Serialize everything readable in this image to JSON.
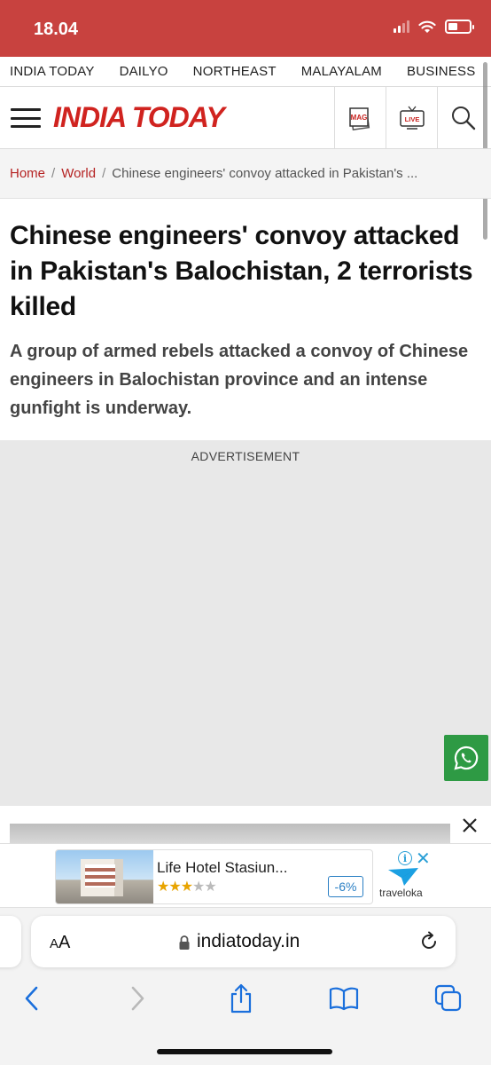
{
  "status_bar": {
    "time": "18.04",
    "bg_color": "#c8423f",
    "icons": [
      "signal-icon",
      "wifi-icon",
      "battery-icon"
    ]
  },
  "top_nav": {
    "items": [
      "INDIA TODAY",
      "DAILYO",
      "NORTHEAST",
      "MALAYALAM",
      "BUSINESS"
    ]
  },
  "header": {
    "logo": "INDIA TODAY",
    "brand_color": "#d0231f",
    "mag_label": "MAG",
    "live_label": "LIVE",
    "icons": [
      "menu-icon",
      "mag-icon",
      "live-tv-icon",
      "search-icon"
    ]
  },
  "breadcrumb": {
    "home": "Home",
    "section": "World",
    "current": "Chinese engineers' convoy attacked in Pakistan's ..."
  },
  "article": {
    "headline": "Chinese engineers' convoy attacked in Pakistan's Balochistan, 2 terrorists killed",
    "summary": "A group of armed rebels attacked a convoy of Chinese engineers in Balochistan province and an intense gunfight is underway."
  },
  "ad": {
    "label": "ADVERTISEMENT",
    "whatsapp_color": "#2e9a44"
  },
  "hotel_ad": {
    "name": "Life Hotel Stasiun...",
    "stars_filled": "★★★",
    "stars_empty": "★★",
    "rating": 3,
    "rating_max": 5,
    "discount": "-6%",
    "brand": "traveloka",
    "info_glyph": "i",
    "close_glyph": "✕"
  },
  "browser": {
    "aa_large": "A",
    "aa_small": "A",
    "url": "indiatoday.in",
    "toolbar": [
      "back-icon",
      "forward-icon",
      "share-icon",
      "bookmarks-icon",
      "tabs-icon"
    ],
    "accent_color": "#1a6fdc"
  }
}
